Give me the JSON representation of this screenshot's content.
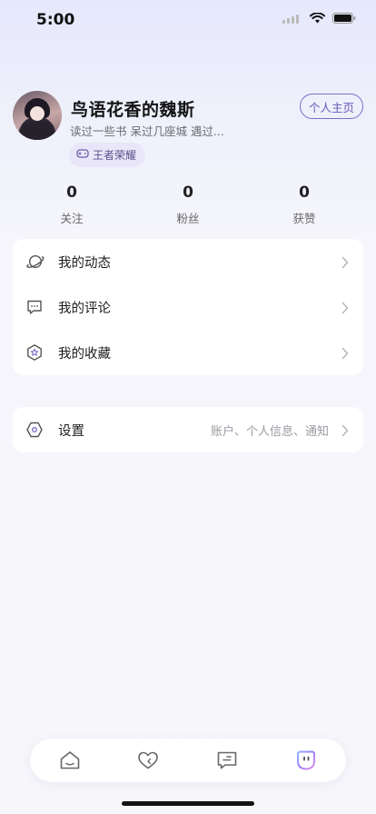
{
  "status_bar": {
    "time": "5:00"
  },
  "profile": {
    "username": "鸟语花香的魏斯",
    "bio": "读过一些书  呆过几座城  遇过...",
    "game_tag": "王者荣耀",
    "homepage_button": "个人主页"
  },
  "stats": [
    {
      "value": "0",
      "label": "关注"
    },
    {
      "value": "0",
      "label": "粉丝"
    },
    {
      "value": "0",
      "label": "获赞"
    }
  ],
  "menu": [
    {
      "label": "我的动态",
      "icon": "planet-icon"
    },
    {
      "label": "我的评论",
      "icon": "comment-icon"
    },
    {
      "label": "我的收藏",
      "icon": "star-hexagon-icon"
    }
  ],
  "settings": {
    "label": "设置",
    "hint": "账户、个人信息、通知",
    "icon": "hexagon-settings-icon"
  },
  "bottom_nav": [
    {
      "name": "home",
      "icon": "home-icon",
      "active": false
    },
    {
      "name": "favorites",
      "icon": "heart-icon",
      "active": false
    },
    {
      "name": "messages",
      "icon": "message-icon",
      "active": false
    },
    {
      "name": "me",
      "icon": "profile-icon",
      "active": true
    }
  ],
  "colors": {
    "accent": "#7e6cc7",
    "tag_bg": "#e9e6f9",
    "background": "#f6f6fb"
  }
}
